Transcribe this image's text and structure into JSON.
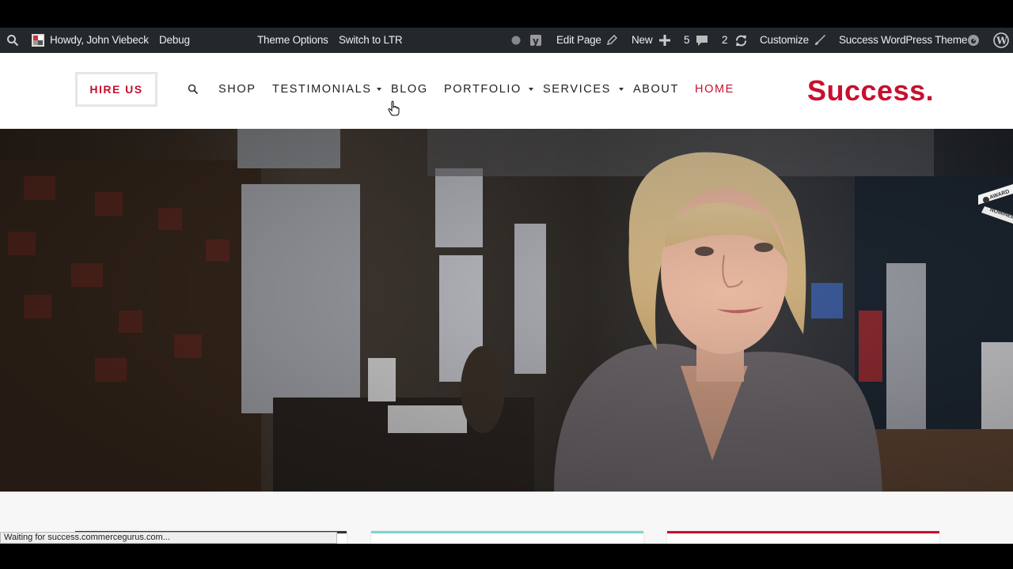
{
  "admin_bar": {
    "howdy": "Howdy, John Viebeck",
    "debug": "Debug",
    "theme_options": "Theme Options",
    "switch_ltr": "Switch to LTR",
    "edit_page": "Edit Page",
    "new": "New",
    "comments_count": "5",
    "updates_count": "2",
    "customize": "Customize",
    "site_name": "Success WordPress Theme"
  },
  "header": {
    "hire_us": "HIRE US",
    "nav": {
      "shop": "SHOP",
      "testimonials": "TESTIMONIALS",
      "blog": "BLOG",
      "portfolio": "PORTFOLIO",
      "services": "SERVICES",
      "about": "ABOUT",
      "home": "HOME"
    },
    "logo": "Success."
  },
  "hero": {
    "badge_line1": "AWARD",
    "badge_line2": "NOMINEE"
  },
  "status_bar": "Waiting for success.commercegurus.com...",
  "colors": {
    "accent": "#c8102e",
    "admin_bg": "#23282d",
    "card_teal": "#7fd3d3",
    "card_red": "#c8102e",
    "card_dark": "#333333"
  }
}
